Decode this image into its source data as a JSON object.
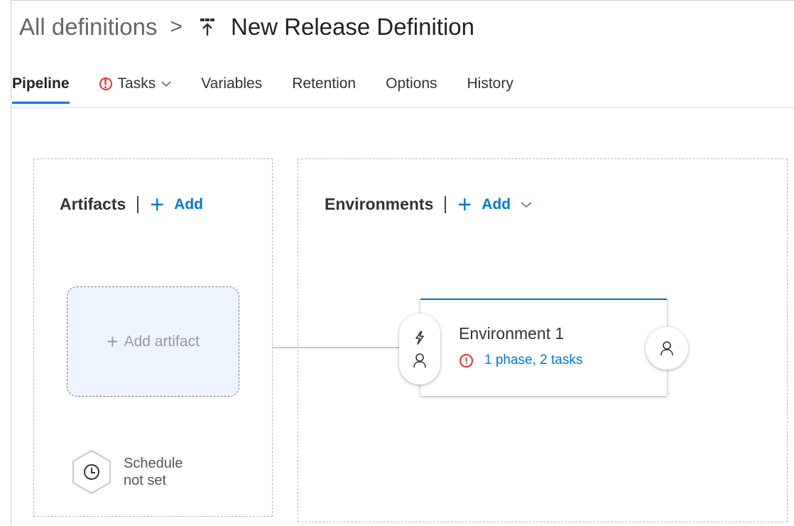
{
  "breadcrumb": {
    "root": "All definitions",
    "separator": ">",
    "definition_icon": "release-definition-icon",
    "title": "New Release Definition"
  },
  "tabs": [
    {
      "label": "Pipeline",
      "active": true
    },
    {
      "label": "Tasks",
      "error": true,
      "has_dropdown": true
    },
    {
      "label": "Variables"
    },
    {
      "label": "Retention"
    },
    {
      "label": "Options"
    },
    {
      "label": "History"
    }
  ],
  "artifacts": {
    "label": "Artifacts",
    "add_label": "Add",
    "add_artifact_label": "Add artifact",
    "schedule_line1": "Schedule",
    "schedule_line2": "not set"
  },
  "environments": {
    "label": "Environments",
    "add_label": "Add",
    "items": [
      {
        "name": "Environment 1",
        "status": "1 phase, 2 tasks"
      }
    ]
  },
  "colors": {
    "accent": "#0078d4",
    "error": "#e03030",
    "artifact_bg": "#eef4fd"
  }
}
